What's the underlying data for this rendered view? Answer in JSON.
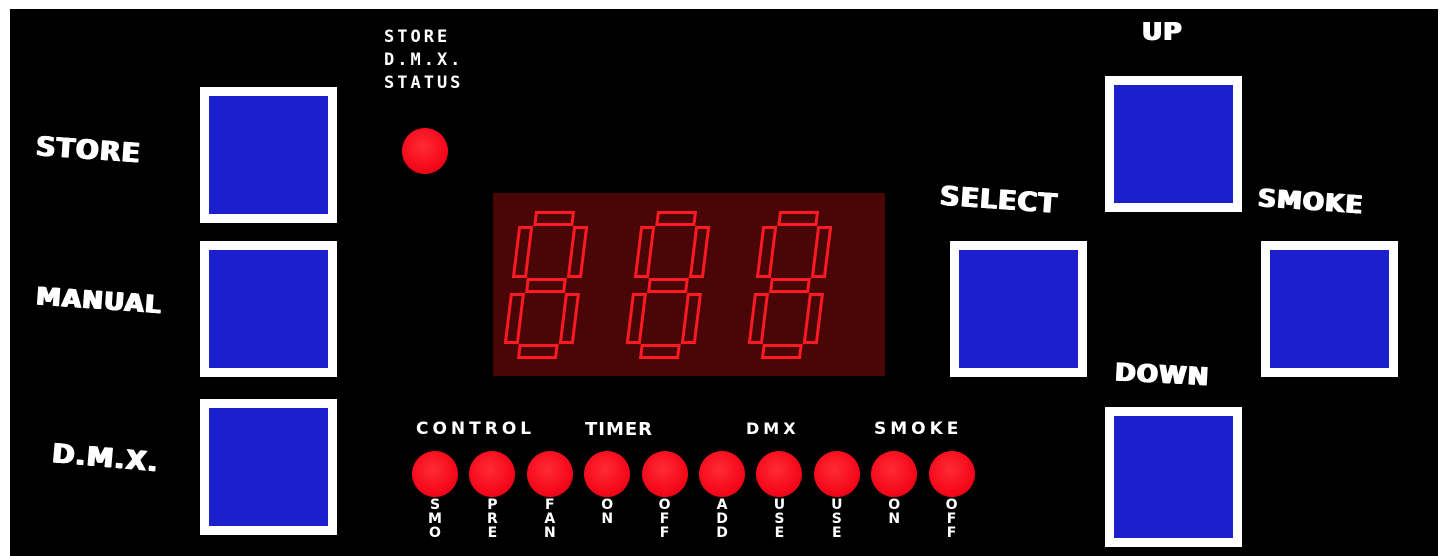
{
  "colors": {
    "panel_background": "#000000",
    "button_face": "#1b1fcc",
    "button_border": "#ffffff",
    "led": "#f5091a",
    "display_background": "#4a0506",
    "segment": "#ff1a23"
  },
  "buttons": {
    "store": "STORE",
    "manual": "MANUAL",
    "dmx": "D.M.X.",
    "select": "SELECT",
    "up": "UP",
    "smoke": "SMOKE",
    "down": "DOWN"
  },
  "status_indicator": {
    "lines": [
      "STORE",
      "D.M.X.",
      "STATUS"
    ]
  },
  "display": {
    "digits": [
      "8",
      "8",
      "8"
    ]
  },
  "indicator_groups": {
    "control": "CONTROL",
    "timer": "TIMER",
    "dmx": "DMX",
    "smoke": "SMOKE"
  },
  "indicators": [
    {
      "label": "SMO"
    },
    {
      "label": "PRE"
    },
    {
      "label": "FAN"
    },
    {
      "label": "ON"
    },
    {
      "label": "OFF"
    },
    {
      "label": "ADD"
    },
    {
      "label": "USE"
    },
    {
      "label": "USE"
    },
    {
      "label": "ON"
    },
    {
      "label": "OFF"
    }
  ]
}
